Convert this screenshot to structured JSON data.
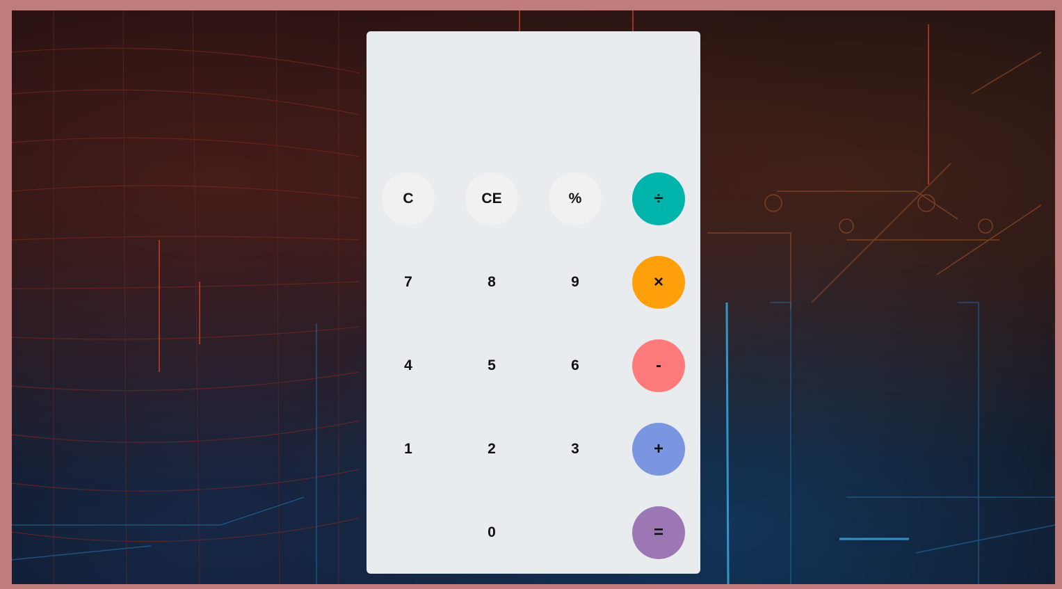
{
  "display": {
    "value": ""
  },
  "keys": {
    "clear": "C",
    "clear_entry": "CE",
    "percent": "%",
    "divide": "÷",
    "seven": "7",
    "eight": "8",
    "nine": "9",
    "multiply": "×",
    "four": "4",
    "five": "5",
    "six": "6",
    "subtract": "-",
    "one": "1",
    "two": "2",
    "three": "3",
    "add": "+",
    "zero": "0",
    "equals": "="
  },
  "colors": {
    "frame": "#c07c7c",
    "calculator_body": "#e9ecef",
    "function_key": "#f1f1f1",
    "divide": "#00b4ac",
    "multiply": "#ff9f0a",
    "subtract": "#ff7b7b",
    "add": "#7b96e0",
    "equals": "#9b78b4"
  }
}
